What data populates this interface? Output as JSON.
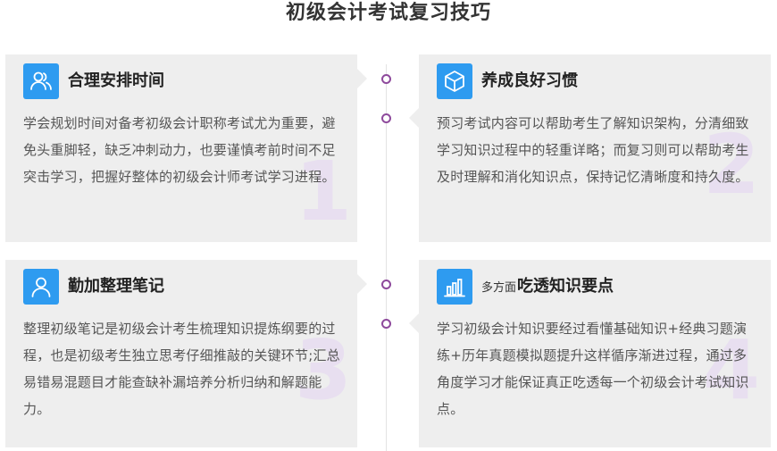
{
  "page": {
    "title": "初级会计考试复习技巧"
  },
  "cards": [
    {
      "title": "合理安排时间",
      "text": "学会规划时间对备考初级会计职称考试尤为重要，避免头重脚轻，缺乏冲刺动力，也要谨慎考前时间不足突击学习，把握好整体的初级会计师考试学习进程。",
      "number": "1",
      "icon": "users-icon"
    },
    {
      "title": "养成良好习惯",
      "text": "预习考试内容可以帮助考生了解知识架构，分清细致学习知识过程中的轻重详略；而复习则可以帮助考生及时理解和消化知识点，保持记忆清晰度和持久度。",
      "number": "2",
      "icon": "cube-icon"
    },
    {
      "title": "勤加整理笔记",
      "text": "整理初级笔记是初级会计考生梳理知识提炼纲要的过程，也是初级考生独立思考仔细推敲的关键环节;汇总易错易混题目才能查缺补漏培养分析归纳和解题能力。",
      "number": "3",
      "icon": "user-icon"
    },
    {
      "title_prefix": "多方面",
      "title": "吃透知识要点",
      "text": "学习初级会计知识要经过看懂基础知识+经典习题演练+历年真题模拟题提升这样循序渐进过程，通过多角度学习才能保证真正吃透每一个初级会计考试知识点。",
      "number": "4",
      "icon": "bar-chart-icon"
    }
  ],
  "colors": {
    "accent": "#2e9bf0",
    "timeline_dot": "#8e4a9c",
    "card_bg": "#eeeeee"
  }
}
